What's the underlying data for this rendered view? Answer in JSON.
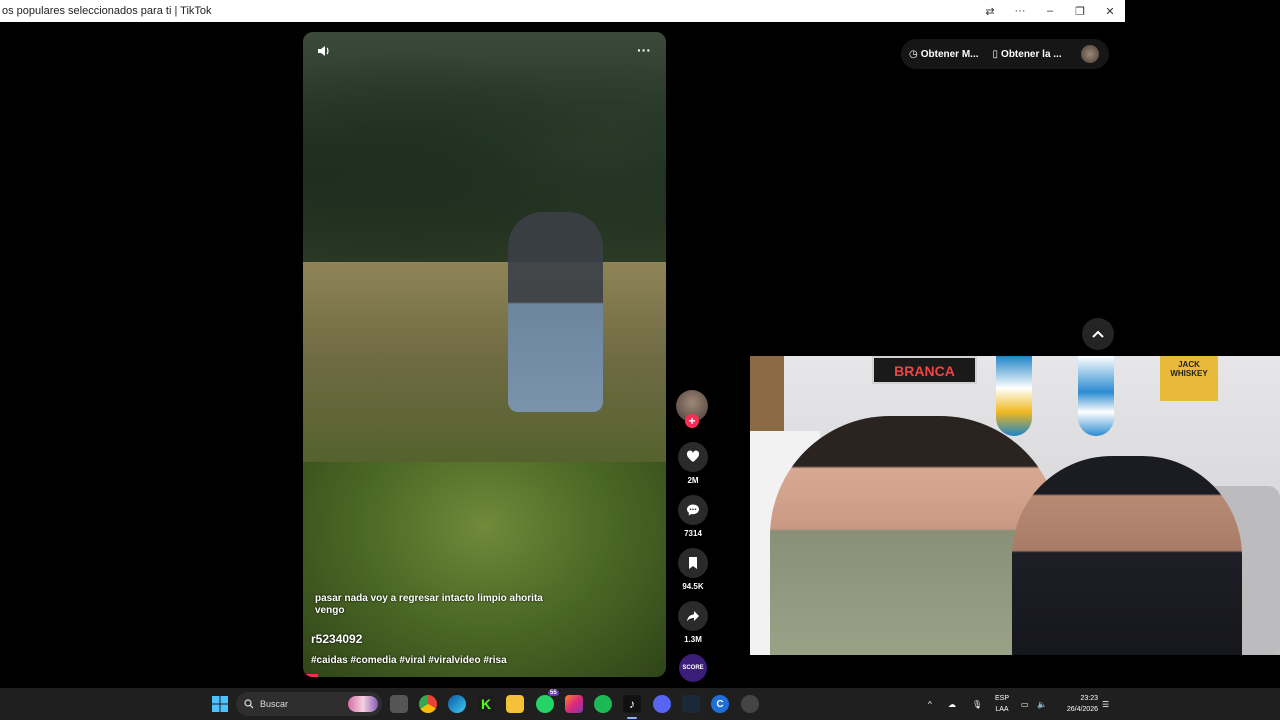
{
  "window": {
    "title": "os populares seleccionados para ti | TikTok"
  },
  "video": {
    "caption": "pasar nada voy a regresar intacto limpio ahorita vengo",
    "username": "r5234092",
    "hashtags": "#caidas #comedia #viral #viralvideo #risa",
    "progress_percent": 4
  },
  "actions": {
    "likes": "2M",
    "comments": "7314",
    "saves": "94.5K",
    "shares": "1.3M",
    "music_label": "SCORE"
  },
  "top_bar": {
    "get_app_1": "Obtener M...",
    "get_app_2": "Obtener la ..."
  },
  "webcam": {
    "sign_left": "BRANCA",
    "sign_right": "JACK WHISKEY"
  },
  "taskbar": {
    "search_placeholder": "Buscar",
    "whatsapp_badge": "55",
    "lang_line1": "ESP",
    "lang_line2": "LAA",
    "time": "23:23",
    "date": "26/4/2026"
  }
}
